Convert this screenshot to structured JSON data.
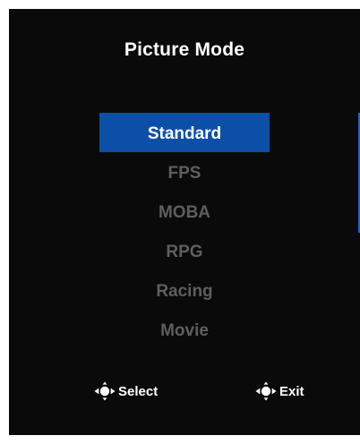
{
  "osd": {
    "title": "Picture Mode",
    "modes": [
      {
        "label": "Standard",
        "selected": true
      },
      {
        "label": "FPS",
        "selected": false
      },
      {
        "label": "MOBA",
        "selected": false
      },
      {
        "label": "RPG",
        "selected": false
      },
      {
        "label": "Racing",
        "selected": false
      },
      {
        "label": "Movie",
        "selected": false
      }
    ],
    "hints": {
      "select_label": "Select",
      "select_icon": "joystick-left-right-icon",
      "exit_label": "Exit",
      "exit_icon": "joystick-left-icon"
    },
    "colors": {
      "background": "#0a0a0a",
      "highlight": "#0c4fa6",
      "inactive_text": "#5e5e5e",
      "active_text": "#ffffff",
      "scroll_indicator": "#1e66c8"
    }
  }
}
